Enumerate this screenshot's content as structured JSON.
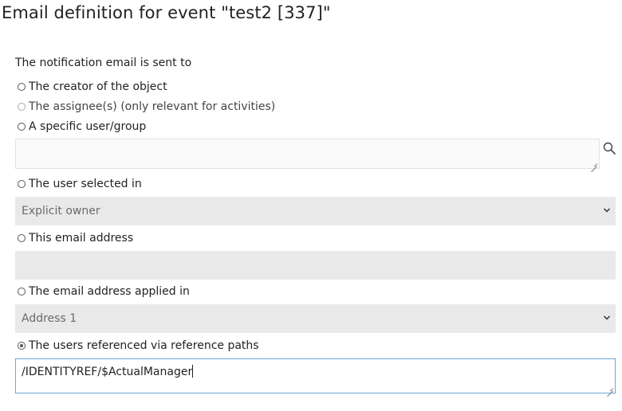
{
  "page": {
    "title": "Email definition for event \"test2 [337]\""
  },
  "form": {
    "intro_label": "The notification email is sent to",
    "options": {
      "creator": "The creator of the object",
      "assignees": "The assignee(s) (only relevant for activities)",
      "specific_user": "A specific user/group",
      "user_selected_in": "The user selected in",
      "email_address": "This email address",
      "email_applied_in": "The email address applied in",
      "reference_paths": "The users referenced via reference paths"
    },
    "selected_option": "reference_paths",
    "specific_user_value": "",
    "user_selected_in_value": "Explicit owner",
    "email_address_value": "",
    "email_applied_in_value": "Address 1",
    "reference_paths_value": "/IDENTITYREF/$ActualManager"
  },
  "icons": {
    "search": "search-icon",
    "dropdown": "chevron-down-icon",
    "resize": "resize-handle-icon"
  }
}
